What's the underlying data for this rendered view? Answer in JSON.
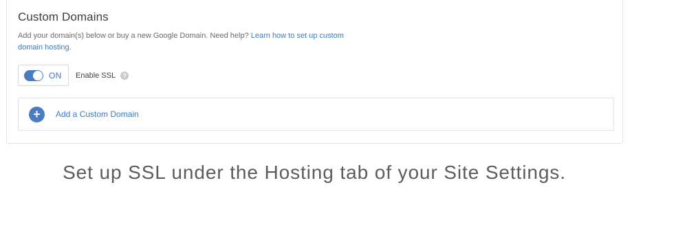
{
  "section": {
    "title": "Custom Domains",
    "description": "Add your domain(s) below or buy a new Google Domain. Need help? ",
    "help_link": "Learn how to set up custom domain hosting",
    "description_end": "."
  },
  "ssl": {
    "toggle_state": "ON",
    "label": "Enable SSL",
    "help_glyph": "?",
    "enabled": true
  },
  "domains": {
    "add_label": "Add a Custom Domain",
    "add_glyph": "+"
  },
  "caption": "Set up SSL under the Hosting tab of your Site Settings.",
  "colors": {
    "accent": "#4a7cc2",
    "link": "#3a7bc0",
    "border": "#e3e3e3"
  },
  "icons": {
    "help": "help-icon",
    "add": "plus-circle-icon"
  }
}
